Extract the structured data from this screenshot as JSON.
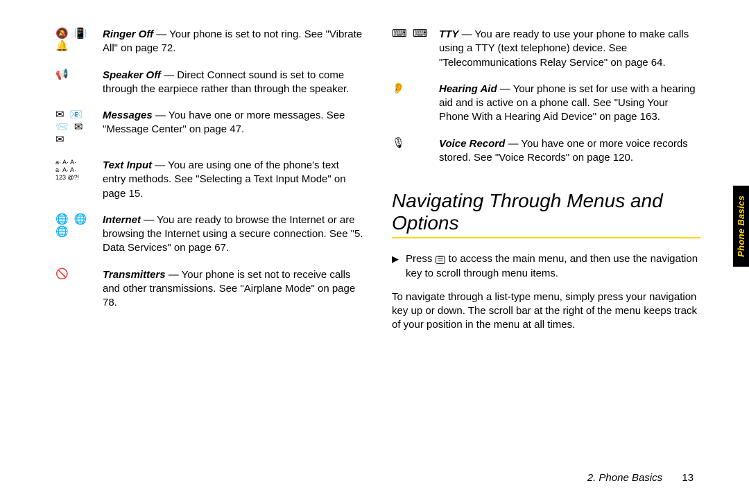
{
  "sideTab": "Phone Basics",
  "footer": {
    "chapter": "2. Phone Basics",
    "page": "13"
  },
  "heading": "Navigating Through Menus and Options",
  "leftEntries": [
    {
      "icons": [
        "🔕 📳",
        "🔔"
      ],
      "term": "Ringer Off",
      "body": " — Your phone is set to not ring. See \"Vibrate All\" on page 72."
    },
    {
      "icons": [
        "📢"
      ],
      "term": "Speaker Off",
      "body": " — Direct Connect sound is set to come through the earpiece rather than through the speaker."
    },
    {
      "icons": [
        "✉ 📧",
        "📨 ✉",
        "✉"
      ],
      "term": "Messages",
      "body": " — You have one or more messages. See \"Message Center\" on page 47."
    },
    {
      "icons": [
        "a· A· A·",
        "a· A· A·",
        "123 @?!"
      ],
      "term": "Text Input",
      "body": " — You are using one of the phone's text entry methods. See \"Selecting a Text Input Mode\" on page 15."
    },
    {
      "icons": [
        "🌐 🌐",
        "🌐"
      ],
      "term": "Internet",
      "body": " — You are ready to browse the Internet or are browsing the Internet using a secure connection. See \"5. Data Services\" on page 67."
    },
    {
      "icons": [
        "🚫"
      ],
      "term": "Transmitters",
      "body": " — Your phone is set not to receive calls and other transmissions. See \"Airplane Mode\" on page 78."
    }
  ],
  "rightEntries": [
    {
      "icons": [
        "⌨ ⌨"
      ],
      "term": "TTY",
      "body": " — You are ready to use your phone to make calls using a TTY (text telephone) device. See \"Telecommunications Relay Service\" on page 64."
    },
    {
      "icons": [
        "👂"
      ],
      "term": "Hearing Aid",
      "body": " — Your phone is set for use with a hearing aid and is active on a phone call. See \"Using Your Phone With a Hearing Aid Device\" on page 163."
    },
    {
      "icons": [
        "🎙"
      ],
      "term": "Voice Record",
      "body": " — You have one or more voice records stored. See \"Voice Records\" on page 120."
    }
  ],
  "bullet": {
    "mark": "▶",
    "pre": "Press ",
    "key": "☰",
    "post": " to access the main menu, and then use the navigation key to scroll through menu items."
  },
  "navPara": "To navigate through a list-type menu, simply press your navigation key up or down. The scroll bar at the right of the menu keeps track of your position in the menu at all times."
}
